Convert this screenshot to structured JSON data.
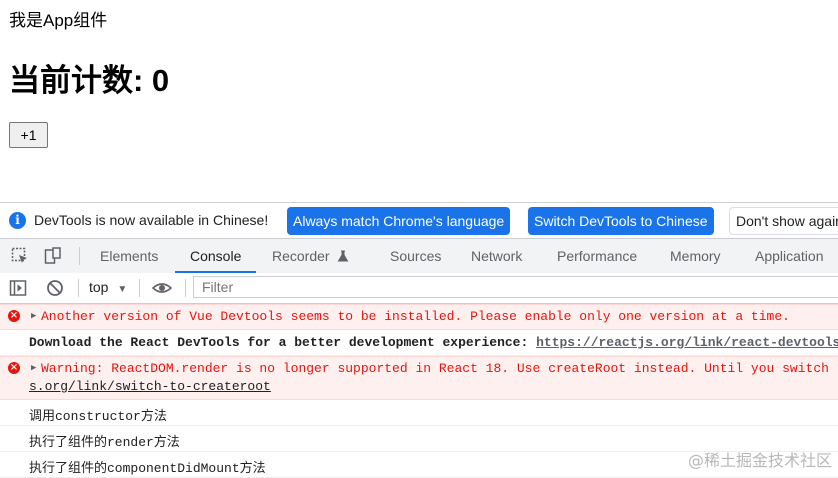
{
  "page": {
    "text": "我是App组件",
    "heading": "当前计数: 0",
    "button": "+1"
  },
  "devtools": {
    "infobar": {
      "message": "DevTools is now available in Chinese!",
      "btn_match": "Always match Chrome's language",
      "btn_switch": "Switch DevTools to Chinese",
      "btn_dismiss": "Don't show again"
    },
    "tabs": [
      "Elements",
      "Console",
      "Recorder",
      "Sources",
      "Network",
      "Performance",
      "Memory",
      "Application"
    ],
    "active_tab": "Console",
    "filterbar": {
      "context": "top",
      "filter_placeholder": "Filter"
    },
    "console": {
      "row1": "Another version of Vue Devtools seems to be installed. Please enable only one version at a time.",
      "row2_text": "Download the React DevTools for a better development experience: ",
      "row2_link": "https://reactjs.org/link/react-devtools",
      "row3_line1": "Warning: ReactDOM.render is no longer supported in React 18. Use createRoot instead. Until you switch to the new API, your app will behave as if it's running React 17. Learn more: https://reactjs.org/link/switch-to-createroot",
      "row3_line2": "s.org/link/switch-to-createroot",
      "row4": "调用constructor方法",
      "row5": "执行了组件的render方法",
      "row6": "执行了组件的componentDidMount方法"
    },
    "colors": {
      "accent": "#1a73e8",
      "error": "#e8140c",
      "error_bg": "#fff0f0"
    }
  },
  "watermark": "@稀土掘金技术社区"
}
